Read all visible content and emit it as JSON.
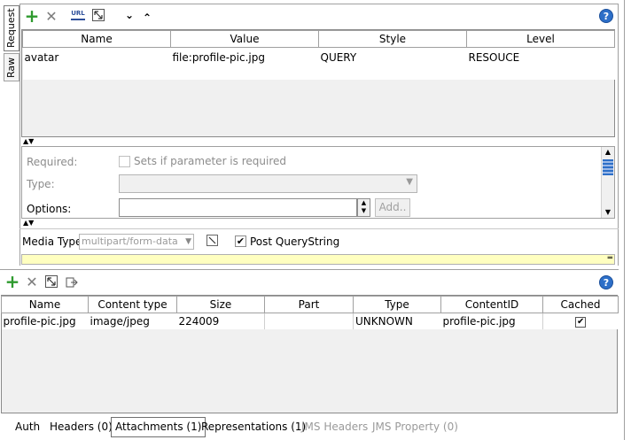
{
  "side_tabs": {
    "request": "Request",
    "raw": "Raw"
  },
  "toolbar": {
    "add": "+",
    "remove": "✕",
    "urlencode": "URL",
    "move_down": "⌄",
    "move_up": "⌃",
    "help": "?"
  },
  "params_table": {
    "columns": [
      "Name",
      "Value",
      "Style",
      "Level"
    ],
    "rows": [
      {
        "name": "avatar",
        "value": "file:profile-pic.jpg",
        "style": "QUERY",
        "level": "RESOUCE"
      }
    ]
  },
  "details": {
    "required_label": "Required:",
    "required_hint": "Sets if parameter is required",
    "type_label": "Type:",
    "options_label": "Options:",
    "add_button": "Add.."
  },
  "media": {
    "label": "Media Type",
    "value": "multipart/form-data",
    "post_qs_label": "Post QueryString",
    "post_qs_checked": true
  },
  "attachments_table": {
    "columns": [
      "Name",
      "Content type",
      "Size",
      "Part",
      "Type",
      "ContentID",
      "Cached"
    ],
    "rows": [
      {
        "name": "profile-pic.jpg",
        "content_type": "image/jpeg",
        "size": "224009",
        "part": "",
        "type": "UNKNOWN",
        "content_id": "profile-pic.jpg",
        "cached": true
      }
    ]
  },
  "bottom_tabs": [
    {
      "label": "Auth",
      "state": "normal"
    },
    {
      "label": "Headers (0)",
      "state": "normal"
    },
    {
      "label": "Attachments (1)",
      "state": "active"
    },
    {
      "label": "Representations (1)",
      "state": "normal"
    },
    {
      "label": "JMS Headers",
      "state": "disabled"
    },
    {
      "label": "JMS Property (0)",
      "state": "disabled"
    }
  ],
  "colors": {
    "accent_green": "#2e9a2e",
    "help_blue": "#2d6fc8",
    "yellow_bar": "#ffffc0",
    "panel_bg": "#f0f0f0"
  }
}
